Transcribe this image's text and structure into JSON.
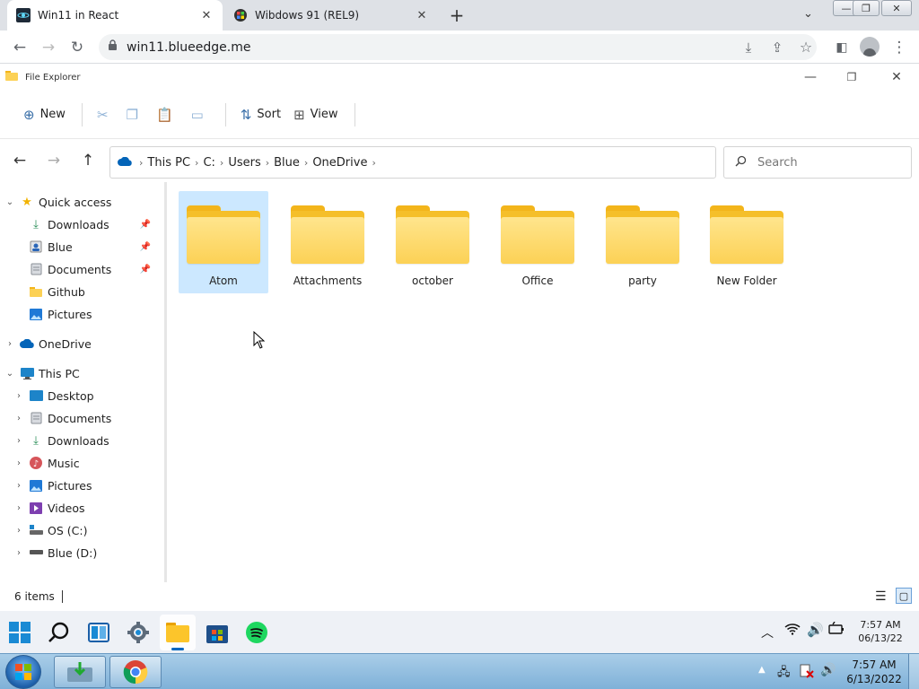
{
  "browser": {
    "tabs": [
      {
        "title": "Win11 in React",
        "active": true
      },
      {
        "title": "Wibdows 91 (REL9)",
        "active": false
      }
    ],
    "url": "win11.blueedge.me"
  },
  "explorer": {
    "window_title": "File Explorer",
    "ribbon": {
      "new_label": "New",
      "sort_label": "Sort",
      "view_label": "View"
    },
    "breadcrumb": [
      "This PC",
      "C:",
      "Users",
      "Blue",
      "OneDrive"
    ],
    "search_placeholder": "Search",
    "sidebar": {
      "quick_access": "Quick access",
      "quick_items": [
        "Downloads",
        "Blue",
        "Documents",
        "Github",
        "Pictures"
      ],
      "onedrive": "OneDrive",
      "this_pc": "This PC",
      "pc_items": [
        "Desktop",
        "Documents",
        "Downloads",
        "Music",
        "Pictures",
        "Videos",
        "OS (C:)",
        "Blue (D:)"
      ]
    },
    "folders": [
      "Atom",
      "Attachments",
      "october",
      "Office",
      "party",
      "New Folder"
    ],
    "selected_folder": "Atom",
    "status": "6 items"
  },
  "win11_taskbar": {
    "time": "7:57 AM",
    "date": "06/13/22"
  },
  "win7_taskbar": {
    "time": "7:57 AM",
    "date": "6/13/2022"
  },
  "colors": {
    "folder": "#fcd155",
    "selection": "#cce8ff",
    "accent": "#0078d4"
  }
}
